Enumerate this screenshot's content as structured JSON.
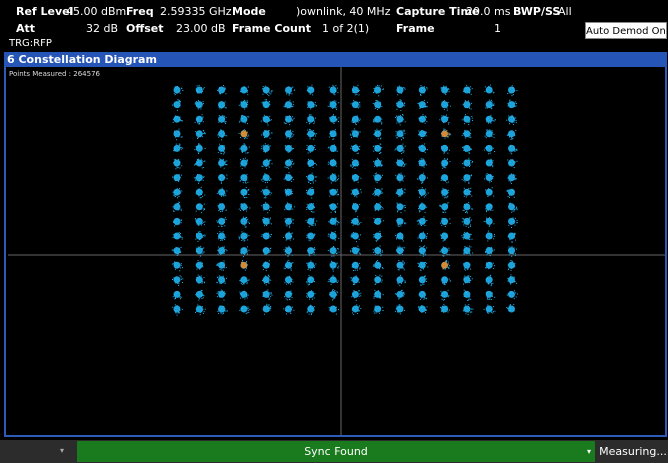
{
  "header": {
    "ref_level_label": "Ref Level",
    "ref_level_value": "45.00 dBm",
    "att_label": "Att",
    "att_value": "32 dB",
    "freq_label": "Freq",
    "freq_value": "2.59335 GHz",
    "offset_label": "Offset",
    "offset_value": "23.00 dB",
    "mode_label": "Mode",
    "mode_value": ")ownlink, 40 MHz",
    "frame_count_label": "Frame Count",
    "frame_count_value": "1 of 2(1)",
    "capture_time_label": "Capture Time",
    "capture_time_value": "20.0 ms",
    "frame_label": "Frame",
    "frame_value": "1",
    "bwp_label": "BWP/SS",
    "bwp_value": "All",
    "trigger": "TRG:RFP",
    "auto_demod_button": "Auto Demod Once"
  },
  "panel": {
    "title": "6 Constellation Diagram",
    "points_measured": "Points Measured : 264576"
  },
  "constellation": {
    "grid": 16,
    "point_color": "#1fb4f0",
    "highlight_color": "#e08a2a",
    "highlight_points": [
      [
        3,
        3
      ],
      [
        12,
        3
      ],
      [
        3,
        12
      ],
      [
        12,
        12
      ]
    ]
  },
  "status_bar": {
    "sync_status": "Sync Found",
    "measuring": "Measuring...",
    "sync_color": "#1a7a1e"
  }
}
